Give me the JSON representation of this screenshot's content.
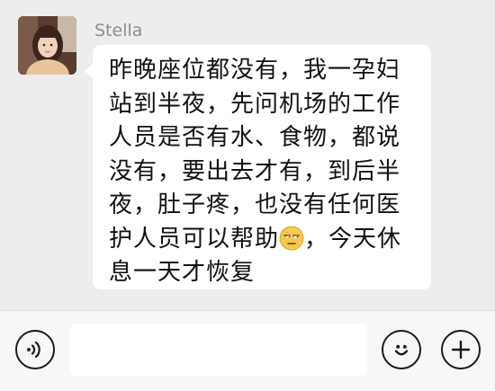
{
  "chat": {
    "sender_name": "Stella",
    "message_lines": [
      "昨晚座位都没有，我一孕妇",
      "站到半夜，先问机场的工作",
      "人员是否有水、食物，都说",
      "没有，要出去才有，到后半",
      "夜，肚子疼，也没有任何医",
      "护人员可以帮助",
      "，今天休",
      "息一天才恢复"
    ],
    "inline_emoji": "unamused-face-emoji"
  },
  "input_bar": {
    "voice_icon": "voice-icon",
    "text_value": "",
    "emoji_icon": "emoji-smile-icon",
    "plus_icon": "plus-icon"
  },
  "colors": {
    "background": "#ededed",
    "bubble": "#ffffff",
    "name_text": "#8c8c8c",
    "input_bar": "#f7f7f7"
  }
}
